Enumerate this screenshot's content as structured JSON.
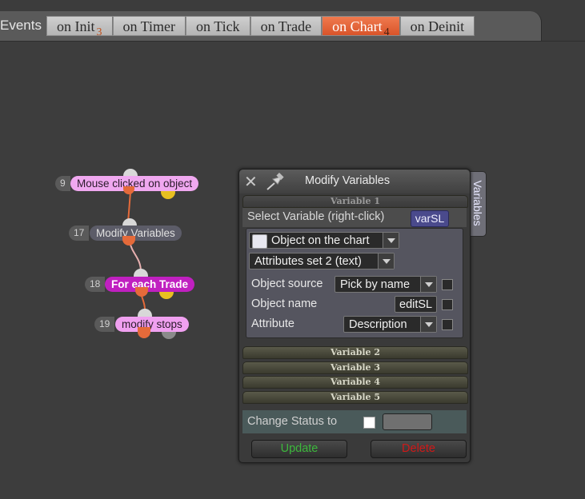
{
  "header": {
    "events_label": "Events",
    "tabs": [
      {
        "label": "on Init",
        "badge": "3",
        "active": false
      },
      {
        "label": "on Timer",
        "badge": "",
        "active": false
      },
      {
        "label": "on Tick",
        "badge": "",
        "active": false
      },
      {
        "label": "on Trade",
        "badge": "",
        "active": false
      },
      {
        "label": "on Chart",
        "badge": "4",
        "active": true
      },
      {
        "label": "on Deinit",
        "badge": "",
        "active": false
      }
    ]
  },
  "nodes": [
    {
      "num": "9",
      "label": "Mouse clicked on object"
    },
    {
      "num": "17",
      "label": "Modify Variables"
    },
    {
      "num": "18",
      "label": "For each Trade"
    },
    {
      "num": "19",
      "label": "modify stops"
    }
  ],
  "panel": {
    "title": "Modify Variables",
    "side_tab": "Variables",
    "variable1": {
      "header": "Variable 1",
      "select_label": "Select Variable (right-click)",
      "selected_var": "varSL",
      "object_type": "Object on the chart",
      "attributes_set": "Attributes set 2 (text)",
      "object_source_label": "Object source",
      "object_source_value": "Pick by name",
      "object_name_label": "Object name",
      "object_name_value": "editSL",
      "attribute_label": "Attribute",
      "attribute_value": "Description"
    },
    "variable_headers": [
      "Variable 2",
      "Variable 3",
      "Variable 4",
      "Variable 5"
    ],
    "change_status_label": "Change Status to",
    "update_label": "Update",
    "delete_label": "Delete"
  },
  "colors": {
    "active_tab": "#e8663a",
    "update_text": "#3cb83c",
    "delete_text": "#d01818",
    "node_pink": "#f0a0f0",
    "node_magenta": "#c020c0",
    "varsl_bg": "#4a4a8c"
  }
}
